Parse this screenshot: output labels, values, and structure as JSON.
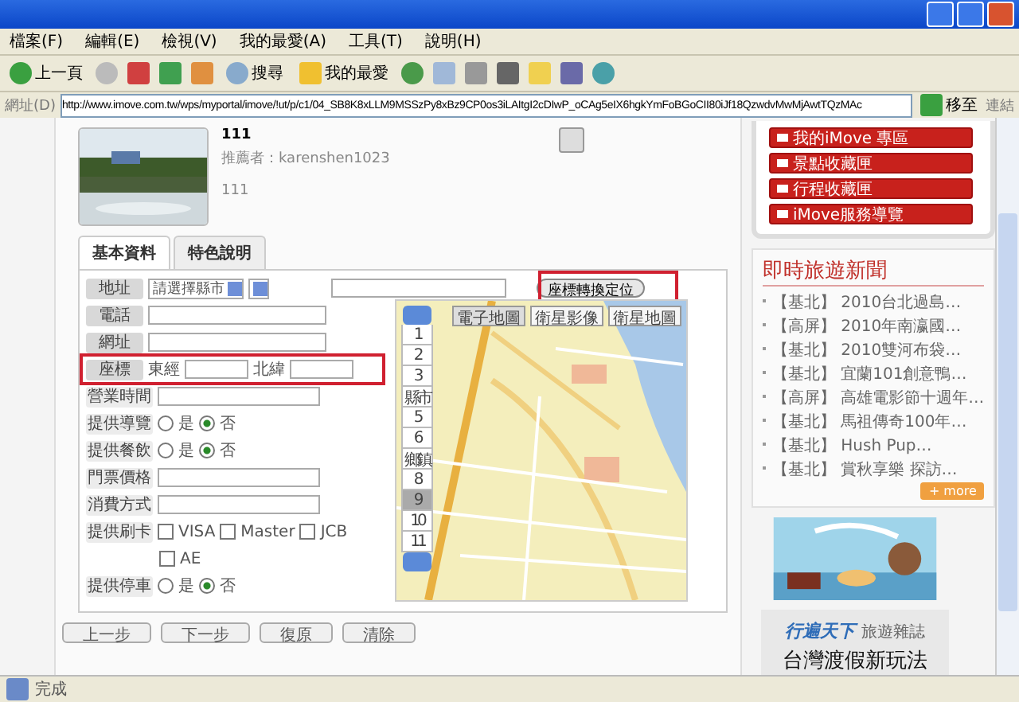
{
  "menu": [
    "檔案(F)",
    "編輯(E)",
    "檢視(V)",
    "我的最愛(A)",
    "工具(T)",
    "說明(H)"
  ],
  "toolbar": {
    "back": "上一頁",
    "search": "搜尋",
    "favorites": "我的最愛"
  },
  "address": {
    "label": "網址(D)",
    "url": "http://www.imove.com.tw/wps/myportal/imove/!ut/p/c1/04_SB8K8xLLM9MSSzPy8xBz9CP0os3iLAItgI2cDIwP_oCAg5eIX6hgkYmFoBGoCII80iJf18QzwdvMwMjAwtTQzMAc",
    "go": "移至",
    "links": "連結"
  },
  "item": {
    "title": "111",
    "recommender": "推薦者：karenshen1023",
    "desc": "111"
  },
  "tabs": [
    {
      "label": "基本資料",
      "selected": true
    },
    {
      "label": "特色說明",
      "selected": false
    }
  ],
  "address_row": {
    "label": "地址",
    "city": "請選擇縣市",
    "convert_button": "座標轉換定位"
  },
  "form": [
    {
      "kind": "input",
      "label": "電話",
      "strong": true
    },
    {
      "kind": "input",
      "label": "網址",
      "strong": true
    },
    {
      "kind": "coords",
      "label": "座標",
      "strong": true,
      "east": "東經",
      "north": "北緯"
    },
    {
      "kind": "input",
      "label": "營業時間",
      "strong": false
    },
    {
      "kind": "radio",
      "label": "提供導覽",
      "strong": false,
      "options": [
        {
          "label": "是",
          "selected": false
        },
        {
          "label": "否",
          "selected": true
        }
      ]
    },
    {
      "kind": "radio",
      "label": "提供餐飲",
      "strong": false,
      "options": [
        {
          "label": "是",
          "selected": false
        },
        {
          "label": "否",
          "selected": true
        }
      ]
    },
    {
      "kind": "input",
      "label": "門票價格",
      "strong": false
    },
    {
      "kind": "input",
      "label": "消費方式",
      "strong": false
    },
    {
      "kind": "checks",
      "label": "提供刷卡",
      "strong": false,
      "options": [
        {
          "label": "VISA",
          "checked": false
        },
        {
          "label": "Master",
          "checked": false
        },
        {
          "label": "JCB",
          "checked": false
        },
        {
          "label": "AE",
          "checked": false
        }
      ]
    },
    {
      "kind": "radio",
      "label": "提供停車",
      "strong": false,
      "options": [
        {
          "label": "是",
          "selected": false
        },
        {
          "label": "否",
          "selected": true
        }
      ]
    }
  ],
  "map": {
    "modes": [
      {
        "label": "電子地圖",
        "selected": true
      },
      {
        "label": "衛星影像",
        "selected": false
      },
      {
        "label": "衛星地圖",
        "selected": false
      }
    ],
    "zoom_levels": [
      {
        "label": "1",
        "selected": false
      },
      {
        "label": "2",
        "selected": false
      },
      {
        "label": "3",
        "selected": false
      },
      {
        "label": "縣市",
        "selected": false
      },
      {
        "label": "5",
        "selected": false
      },
      {
        "label": "6",
        "selected": false
      },
      {
        "label": "鄉鎮",
        "selected": false
      },
      {
        "label": "8",
        "selected": false
      },
      {
        "label": "9",
        "selected": true
      },
      {
        "label": "10",
        "selected": false
      },
      {
        "label": "11",
        "selected": false
      }
    ]
  },
  "steps": [
    "上一步",
    "下一步",
    "復原",
    "清除"
  ],
  "side_links": [
    "我的iMove 專區",
    "景點收藏匣",
    "行程收藏匣",
    "iMove服務導覽"
  ],
  "news": {
    "title": "即時旅遊新聞",
    "items": [
      {
        "tag": "【基北】",
        "text": "2010台北過島…"
      },
      {
        "tag": "【高屏】",
        "text": "2010年南瀛國…"
      },
      {
        "tag": "【基北】",
        "text": "2010雙河布袋…"
      },
      {
        "tag": "【基北】",
        "text": "宜蘭101創意鴨…"
      },
      {
        "tag": "【高屏】",
        "text": "高雄電影節十週年…"
      },
      {
        "tag": "【基北】",
        "text": "馬祖傳奇100年…"
      },
      {
        "tag": "【基北】",
        "text": "Hush Pup…"
      },
      {
        "tag": "【基北】",
        "text": "賞秋享樂 探訪…"
      }
    ],
    "more": "+ more"
  },
  "ad": {
    "brand": "行遍天下",
    "sub": "旅遊雜誌",
    "headline": "台灣渡假新玩法"
  },
  "status": "完成"
}
